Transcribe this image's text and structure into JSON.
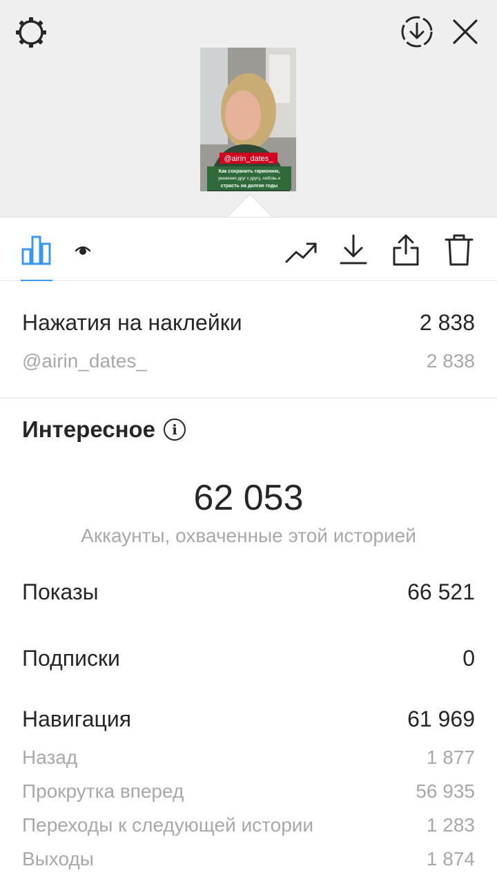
{
  "story": {
    "username_sticker": "@airin_dates_",
    "caption": [
      "Как сохранить гармонию,",
      "уважение друг к другу, любовь и",
      "страсть на долгие годы"
    ]
  },
  "colors": {
    "accent": "#3897f0",
    "sticker_red": "#d2001f",
    "caption_green": "#2f6b3a"
  },
  "toolbar": {
    "icons": [
      "bar-chart-icon",
      "eye-icon",
      "trending-up-icon",
      "download-icon",
      "share-icon",
      "trash-icon"
    ],
    "active_tab": "bar-chart-icon"
  },
  "sticker_taps": {
    "label": "Нажатия на наклейки",
    "value": "2 838",
    "items": [
      {
        "label": "@airin_dates_",
        "value": "2 838"
      }
    ]
  },
  "discovery": {
    "title": "Интересное",
    "reach_value": "62 053",
    "reach_label": "Аккаунты, охваченные этой историей",
    "impressions": {
      "label": "Показы",
      "value": "66 521"
    },
    "follows": {
      "label": "Подписки",
      "value": "0"
    },
    "navigation": {
      "label": "Навигация",
      "value": "61 969",
      "items": [
        {
          "label": "Назад",
          "value": "1 877"
        },
        {
          "label": "Прокрутка вперед",
          "value": "56 935"
        },
        {
          "label": "Переходы к следующей истории",
          "value": "1 283"
        },
        {
          "label": "Выходы",
          "value": "1 874"
        }
      ]
    }
  }
}
